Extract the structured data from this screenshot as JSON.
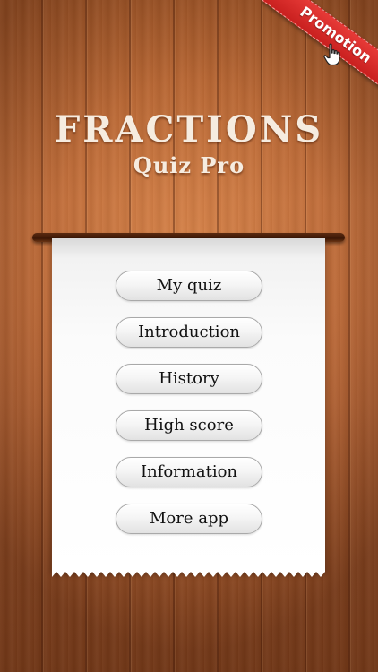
{
  "title": {
    "main": "FRACTIONS",
    "sub": "Quiz Pro"
  },
  "promotion": {
    "label": "Promotion",
    "icon": "hand-pointer-icon"
  },
  "menu": {
    "items": [
      {
        "label": "My quiz"
      },
      {
        "label": "Introduction"
      },
      {
        "label": "History"
      },
      {
        "label": "High score"
      },
      {
        "label": "Information"
      },
      {
        "label": "More app"
      }
    ]
  },
  "colors": {
    "wood": "#b8673a",
    "ribbon": "#d42b29",
    "paper": "#ffffff",
    "title_text": "#f6ece0"
  }
}
